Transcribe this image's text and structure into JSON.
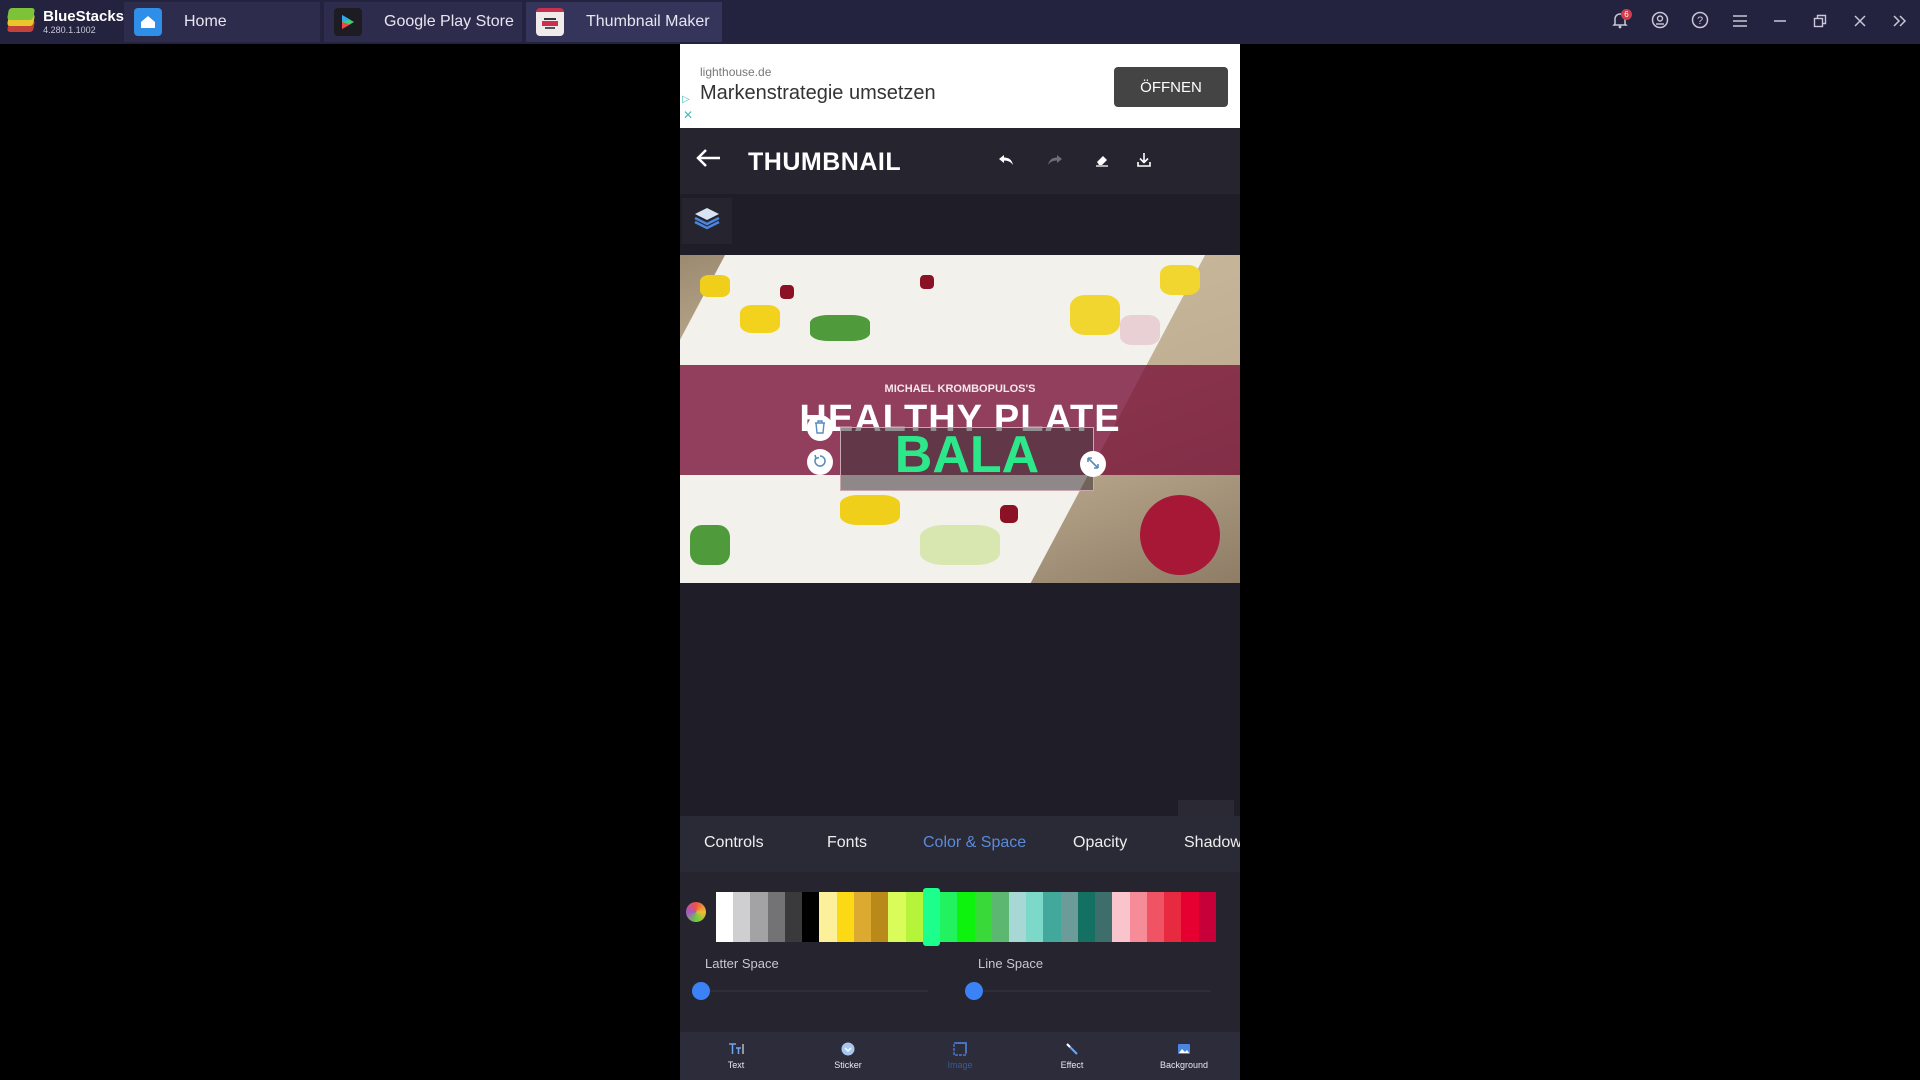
{
  "titlebar": {
    "brand_name": "BlueStacks",
    "brand_version": "4.280.1.1002",
    "tabs": [
      {
        "label": "Home",
        "icon": "home-icon"
      },
      {
        "label": "Google Play Store",
        "icon": "play-store-icon"
      },
      {
        "label": "Thumbnail Maker",
        "icon": "thumbnail-maker-icon",
        "active": true
      }
    ],
    "notification_count": "6",
    "controls": [
      "bell-icon",
      "account-icon",
      "help-icon",
      "menu-icon",
      "minimize-icon",
      "restore-icon",
      "close-icon",
      "expand-sidebar-icon"
    ]
  },
  "ad": {
    "domain": "lighthouse.de",
    "headline": "Markenstrategie umsetzen",
    "button_label": "ÖFFNEN"
  },
  "appbar": {
    "title": "THUMBNAIL",
    "actions": [
      "undo-icon",
      "redo-icon",
      "eraser-icon",
      "download-icon"
    ]
  },
  "canvas": {
    "subtitle": "MICHAEL KROMBOPULOS'S",
    "headline": "HEALTHY PLATE",
    "selected_text": "BALA",
    "selected_text_color": "#2de88a",
    "band_color": "#7b173c"
  },
  "editor_tabs": [
    {
      "label": "Controls"
    },
    {
      "label": "Fonts"
    },
    {
      "label": "Color & Space",
      "active": true
    },
    {
      "label": "Opacity"
    },
    {
      "label": "Shadow"
    }
  ],
  "palette": {
    "selected_index": 12,
    "colors": [
      "#ffffff",
      "#cfcfd2",
      "#a3a3a6",
      "#737376",
      "#3a3a3d",
      "#000000",
      "#fdf09a",
      "#fbd915",
      "#dcaa30",
      "#b98a1a",
      "#dafc5a",
      "#b6f43a",
      "#1dff8c",
      "#22f260",
      "#0ef30e",
      "#38d938",
      "#5cb870",
      "#a8d8d6",
      "#7cd8c8",
      "#43a89c",
      "#6c9c9a",
      "#147062",
      "#3e6e6c",
      "#f9c4cc",
      "#f58c98",
      "#ef5364",
      "#e82a40",
      "#e60032",
      "#c8003a"
    ]
  },
  "sliders": {
    "letter_space": {
      "label": "Latter Space",
      "value": 0
    },
    "line_space": {
      "label": "Line Space",
      "value": 0
    }
  },
  "bottom_nav": [
    {
      "label": "Text",
      "icon": "text-icon"
    },
    {
      "label": "Sticker",
      "icon": "sticker-icon"
    },
    {
      "label": "Image",
      "icon": "image-icon",
      "active": true
    },
    {
      "label": "Effect",
      "icon": "magic-wand-icon"
    },
    {
      "label": "Background",
      "icon": "background-icon"
    }
  ]
}
